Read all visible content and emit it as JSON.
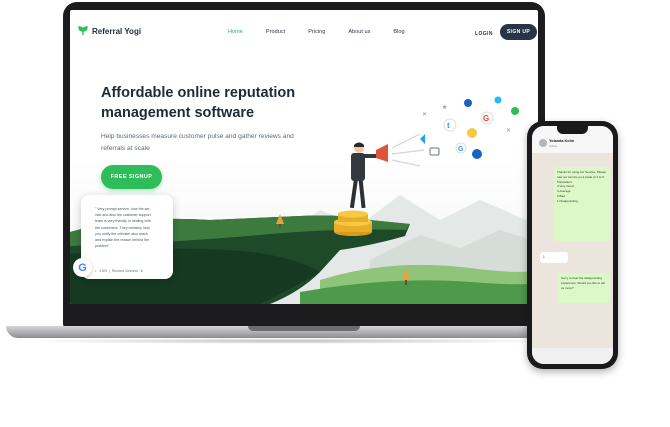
{
  "nav": {
    "brand": "Referral Yogi",
    "items": [
      {
        "label": "Home",
        "active": true
      },
      {
        "label": "Product",
        "active": false
      },
      {
        "label": "Pricing",
        "active": false
      },
      {
        "label": "About us",
        "active": false
      },
      {
        "label": "Blog",
        "active": false
      }
    ],
    "login": "LOGIN",
    "signup": "SIGN UP"
  },
  "hero": {
    "title_line1": "Affordable online reputation",
    "title_line2": "management software",
    "subtitle_line1": "Help businesses measure customer pulse and gather reviews and",
    "subtitle_line2": "referrals at scale",
    "cta": "FREE SIGNUP"
  },
  "review": {
    "lines": [
      "\" Very prompt service, love the ser-",
      "vice and also the customer support",
      "team is very friendly in dealing with",
      "the customers. They certainly help",
      "you notify the criticism also reach",
      "and explain the reason behind the",
      "problem\""
    ],
    "rating": "4.8/5",
    "author": "Richard Johnson"
  },
  "phone": {
    "contact": "Yolanda Kohn",
    "contact_sub": "online",
    "message_intro": "Thanks for using our Service. Please rate our service on a scale of 1 to 5",
    "options": [
      "5 Excellent",
      "4 Very Good",
      "3 Average",
      "2 Bad",
      "1 Disappointing"
    ],
    "reply": "1",
    "followup": "Sorry to hear the disappointing experience. Would you like to tell us more?"
  },
  "colors": {
    "accent": "#2ebd59",
    "navy": "#263648",
    "cliff": "#2d5a35"
  }
}
